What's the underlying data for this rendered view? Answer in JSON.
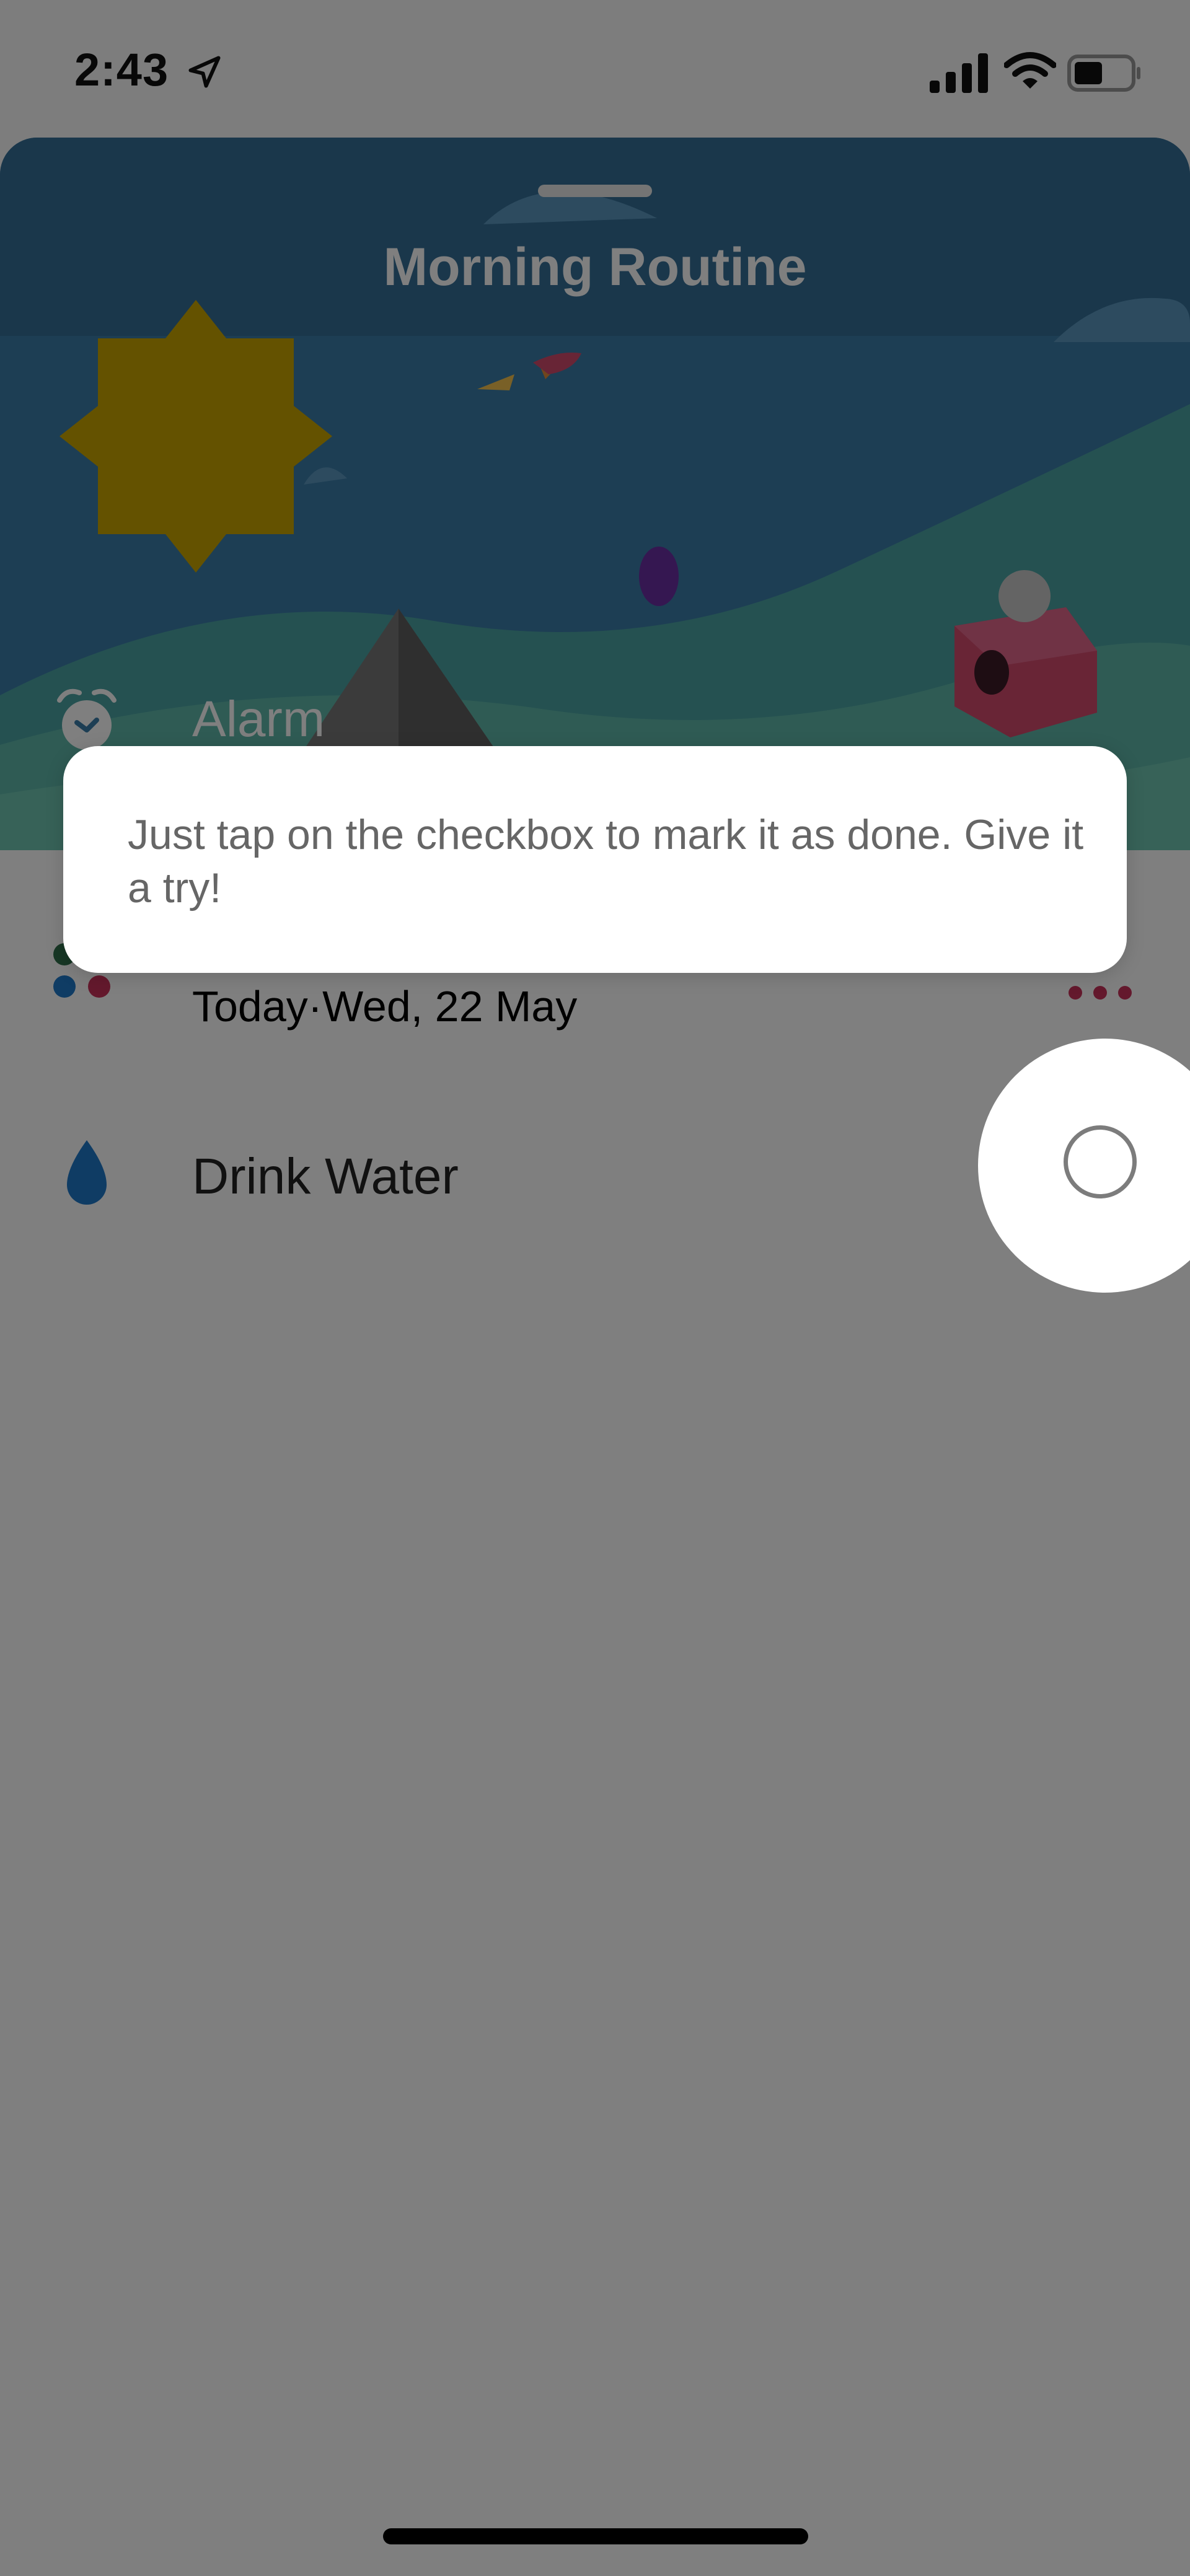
{
  "status_bar": {
    "time": "2:43",
    "icons": [
      "location-arrow-icon",
      "cellular-signal-icon",
      "wifi-icon",
      "battery-icon"
    ]
  },
  "sheet": {
    "title": "Morning Routine"
  },
  "tasks": [
    {
      "label": "Alarm",
      "icon": "alarm-clock-icon"
    },
    {
      "label": "",
      "subtitle": "Today·Wed, 22 May",
      "icon": "dots-icon",
      "menu_icon": "more-dots-icon"
    },
    {
      "label": "Drink Water",
      "icon": "water-drop-icon"
    }
  ],
  "tooltip": {
    "text": "Just tap on the checkbox to mark it as done. Give it a try!"
  },
  "colors": {
    "hero_sky": "#3b7da8",
    "sun": "#c9a400",
    "water_drop": "#1f78c8",
    "dim_overlay": "rgba(0,0,0,0.5)",
    "checkbox_ring": "#7c7c7c"
  }
}
